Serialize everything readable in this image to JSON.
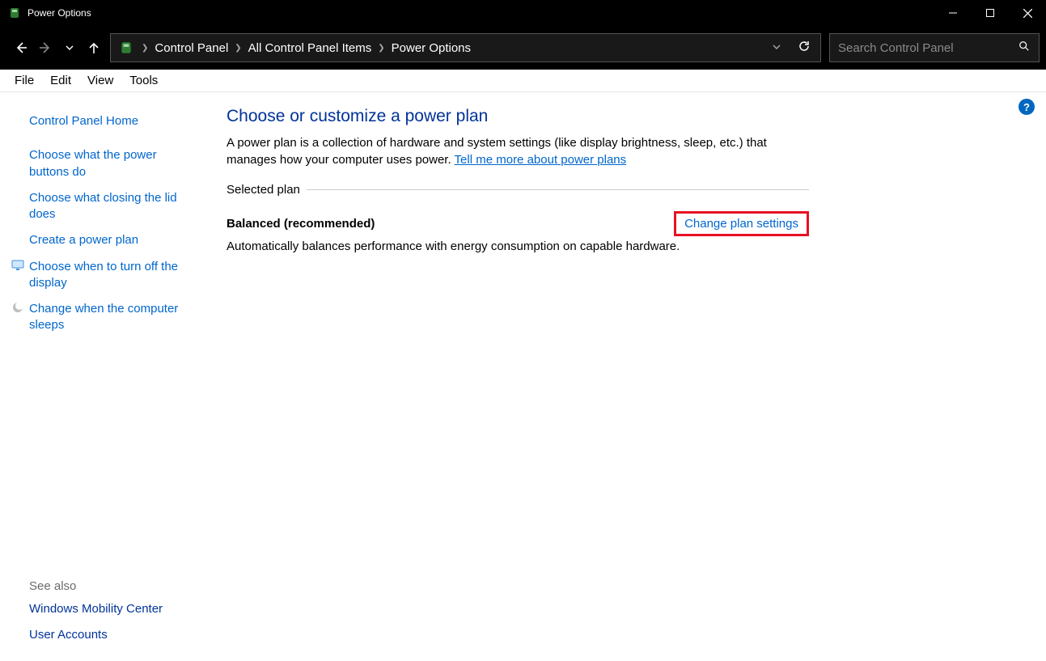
{
  "window": {
    "title": "Power Options"
  },
  "breadcrumbs": {
    "items": [
      "Control Panel",
      "All Control Panel Items",
      "Power Options"
    ]
  },
  "search": {
    "placeholder": "Search Control Panel"
  },
  "menubar": {
    "items": [
      "File",
      "Edit",
      "View",
      "Tools"
    ]
  },
  "sidebar": {
    "home": "Control Panel Home",
    "links": [
      {
        "label": "Choose what the power buttons do",
        "icon": null
      },
      {
        "label": "Choose what closing the lid does",
        "icon": null
      },
      {
        "label": "Create a power plan",
        "icon": null
      },
      {
        "label": "Choose when to turn off the display",
        "icon": "monitor-icon"
      },
      {
        "label": "Change when the computer sleeps",
        "icon": "moon-icon"
      }
    ],
    "see_also_header": "See also",
    "see_also": [
      {
        "label": "Windows Mobility Center"
      },
      {
        "label": "User Accounts"
      }
    ]
  },
  "main": {
    "heading": "Choose or customize a power plan",
    "description_prefix": "A power plan is a collection of hardware and system settings (like display brightness, sleep, etc.) that manages how your computer uses power. ",
    "description_link": "Tell me more about power plans",
    "fieldset_legend": "Selected plan",
    "plan": {
      "name": "Balanced (recommended)",
      "change_link": "Change plan settings",
      "description": "Automatically balances performance with energy consumption on capable hardware."
    }
  },
  "help_badge": "?"
}
